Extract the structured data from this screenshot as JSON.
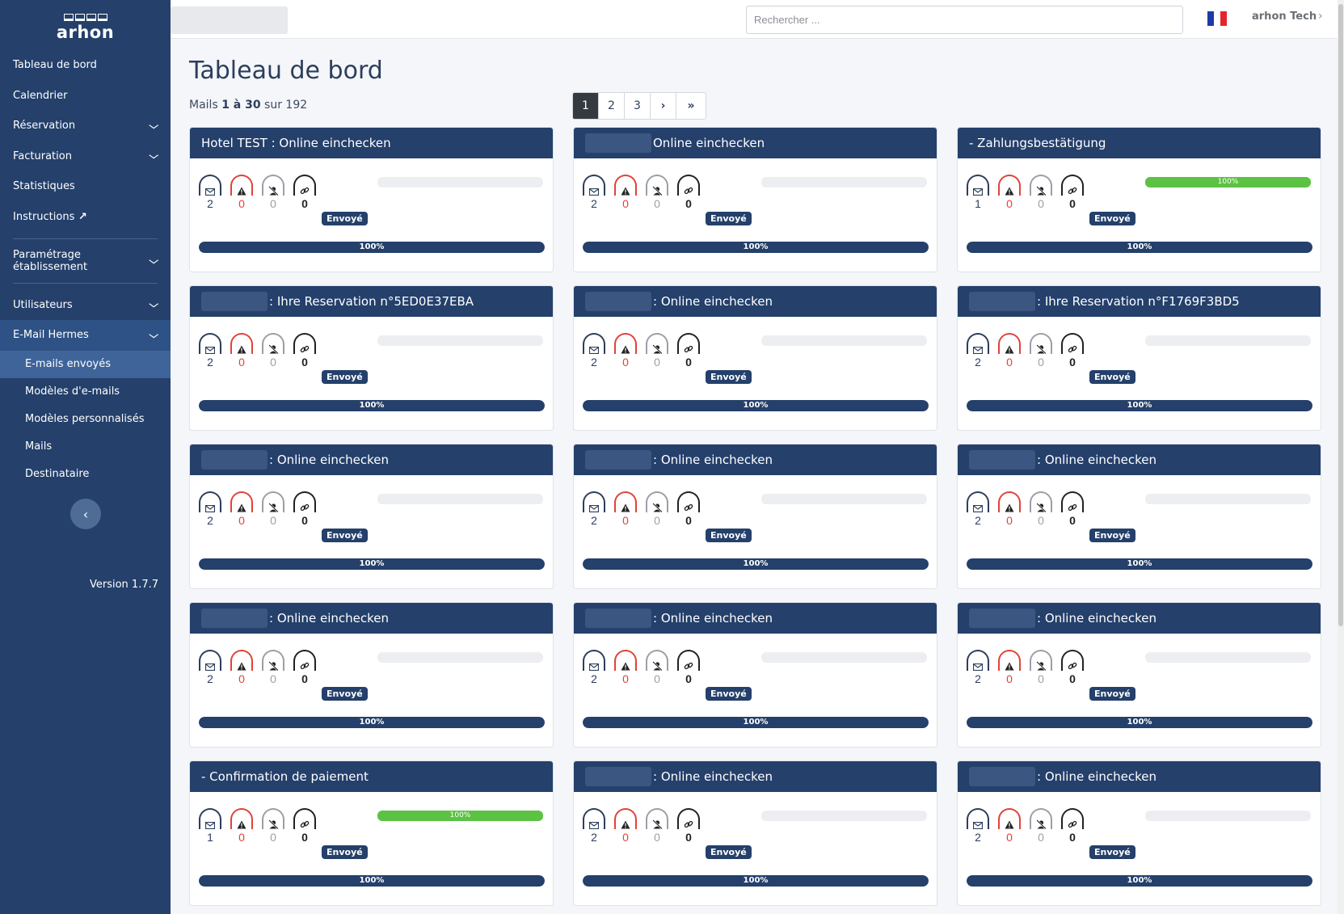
{
  "brand": {
    "name": "arhon"
  },
  "sidebar": {
    "items": [
      {
        "label": "Tableau de bord",
        "has_chevron": false
      },
      {
        "label": "Calendrier",
        "has_chevron": false
      },
      {
        "label": "Réservation",
        "has_chevron": true
      },
      {
        "label": "Facturation",
        "has_chevron": true
      },
      {
        "label": "Statistiques",
        "has_chevron": false
      },
      {
        "label": "Instructions",
        "has_chevron": false,
        "icon": "external-link-icon"
      }
    ],
    "settings_item": {
      "label": "Paramétrage établissement",
      "has_chevron": true
    },
    "lower_items": [
      {
        "label": "Utilisateurs",
        "has_chevron": true
      },
      {
        "label": "E-Mail Hermes",
        "has_chevron": true,
        "open": true
      }
    ],
    "sub_items": [
      {
        "label": "E-mails envoyés",
        "active": true
      },
      {
        "label": "Modèles d'e-mails",
        "active": false
      },
      {
        "label": "Modèles personnalisés",
        "active": false
      },
      {
        "label": "Mails",
        "active": false
      },
      {
        "label": "Destinataire",
        "active": false
      }
    ],
    "collapse_icon": "chevron-left-icon",
    "version": "Version 1.7.7"
  },
  "topbar": {
    "search_placeholder": "Rechercher ...",
    "language_flag": "fr-flag-icon",
    "user_name": "arhon Tech"
  },
  "main": {
    "title": "Tableau de bord",
    "summary": {
      "prefix": "Mails ",
      "range": "1 à 30",
      "suffix": " sur 192"
    },
    "pagination": [
      "1",
      "2",
      "3",
      "›",
      "»"
    ],
    "current_page": "1"
  },
  "colors": {
    "navy": "#24406b",
    "red": "#e0433a",
    "green": "#5cc243",
    "grey": "#9aa0a6"
  },
  "card_common": {
    "status": "Envoyé",
    "progress_label": "100%",
    "progress": 1.0
  },
  "cards": [
    {
      "title": "Hotel TEST : Online einchecken",
      "blur": false,
      "mail": "2",
      "warn": "0",
      "blocked": "0",
      "link": "0",
      "top_progress": ""
    },
    {
      "title": "Online einchecken",
      "blur": true,
      "mail": "2",
      "warn": "0",
      "blocked": "0",
      "link": "0",
      "top_progress": ""
    },
    {
      "title": "- Zahlungsbestätigung",
      "blur": false,
      "mail": "1",
      "warn": "0",
      "blocked": "0",
      "link": "0",
      "top_progress": "100%"
    },
    {
      "title": ": Ihre Reservation n°5ED0E37EBA",
      "blur": true,
      "mail": "2",
      "warn": "0",
      "blocked": "0",
      "link": "0",
      "top_progress": ""
    },
    {
      "title": ": Online einchecken",
      "blur": true,
      "mail": "2",
      "warn": "0",
      "blocked": "0",
      "link": "0",
      "top_progress": ""
    },
    {
      "title": ": Ihre Reservation n°F1769F3BD5",
      "blur": true,
      "mail": "2",
      "warn": "0",
      "blocked": "0",
      "link": "0",
      "top_progress": ""
    },
    {
      "title": ": Online einchecken",
      "blur": true,
      "mail": "2",
      "warn": "0",
      "blocked": "0",
      "link": "0",
      "top_progress": ""
    },
    {
      "title": ": Online einchecken",
      "blur": true,
      "mail": "2",
      "warn": "0",
      "blocked": "0",
      "link": "0",
      "top_progress": ""
    },
    {
      "title": ": Online einchecken",
      "blur": true,
      "mail": "2",
      "warn": "0",
      "blocked": "0",
      "link": "0",
      "top_progress": ""
    },
    {
      "title": ": Online einchecken",
      "blur": true,
      "mail": "2",
      "warn": "0",
      "blocked": "0",
      "link": "0",
      "top_progress": ""
    },
    {
      "title": ": Online einchecken",
      "blur": true,
      "mail": "2",
      "warn": "0",
      "blocked": "0",
      "link": "0",
      "top_progress": ""
    },
    {
      "title": ": Online einchecken",
      "blur": true,
      "mail": "2",
      "warn": "0",
      "blocked": "0",
      "link": "0",
      "top_progress": ""
    },
    {
      "title": "- Confirmation de paiement",
      "blur": false,
      "mail": "1",
      "warn": "0",
      "blocked": "0",
      "link": "0",
      "top_progress": "100%"
    },
    {
      "title": ": Online einchecken",
      "blur": true,
      "mail": "2",
      "warn": "0",
      "blocked": "0",
      "link": "0",
      "top_progress": ""
    },
    {
      "title": ": Online einchecken",
      "blur": true,
      "mail": "2",
      "warn": "0",
      "blocked": "0",
      "link": "0",
      "top_progress": ""
    }
  ]
}
